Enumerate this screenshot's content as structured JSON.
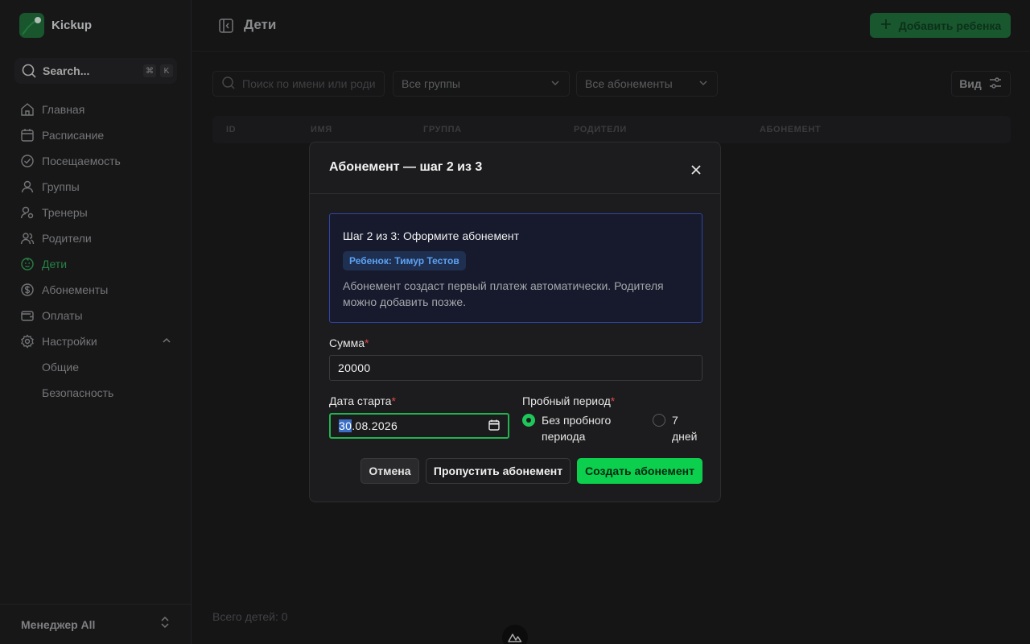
{
  "app": {
    "name": "Kickup"
  },
  "search": {
    "placeholder": "Search...",
    "kbd1": "⌘",
    "kbd2": "K"
  },
  "nav": {
    "items": [
      {
        "label": "Главная",
        "icon": "home-icon"
      },
      {
        "label": "Расписание",
        "icon": "calendar-icon"
      },
      {
        "label": "Посещаемость",
        "icon": "check-circle-icon"
      },
      {
        "label": "Группы",
        "icon": "group-icon"
      },
      {
        "label": "Тренеры",
        "icon": "coach-icon"
      },
      {
        "label": "Родители",
        "icon": "parents-icon"
      },
      {
        "label": "Дети",
        "icon": "baby-icon"
      },
      {
        "label": "Абонементы",
        "icon": "dollar-circle-icon"
      },
      {
        "label": "Оплаты",
        "icon": "wallet-icon"
      },
      {
        "label": "Настройки",
        "icon": "gear-icon"
      }
    ],
    "sub_items": [
      "Общие",
      "Безопасность"
    ],
    "active_color": "#2f9e53"
  },
  "user": {
    "name": "Менеджер All"
  },
  "page": {
    "title": "Дети",
    "add_button": "Добавить ребенка",
    "search_placeholder": "Поиск по имени или роди",
    "filter_groups": "Все группы",
    "filter_subscriptions": "Все абонементы",
    "view_button": "Вид",
    "columns": [
      "ID",
      "ИМЯ",
      "ГРУППА",
      "РОДИТЕЛИ",
      "АБОНЕМЕНТ"
    ],
    "total": "Всего детей: 0"
  },
  "modal": {
    "title": "Абонемент — шаг 2 из 3",
    "info_title": "Шаг 2 из 3: Оформите абонемент",
    "child_chip": "Ребенок: Тимур Тестов",
    "info_desc": "Абонемент создаст первый платеж автоматически. Родителя можно добавить позже.",
    "amount_label": "Сумма",
    "amount_value": "20000",
    "date_label": "Дата старта",
    "date_day": "30",
    "date_rest": ".08.2026",
    "trial_label": "Пробный период",
    "trial_options": [
      "Без пробного периода",
      "7 дней"
    ],
    "trial_selected": 0,
    "required_mark": "*",
    "cancel": "Отмена",
    "skip": "Пропустить абонемент",
    "create": "Создать абонемент",
    "accent": "#0ccf4d",
    "info_border": "#2f44a8"
  }
}
